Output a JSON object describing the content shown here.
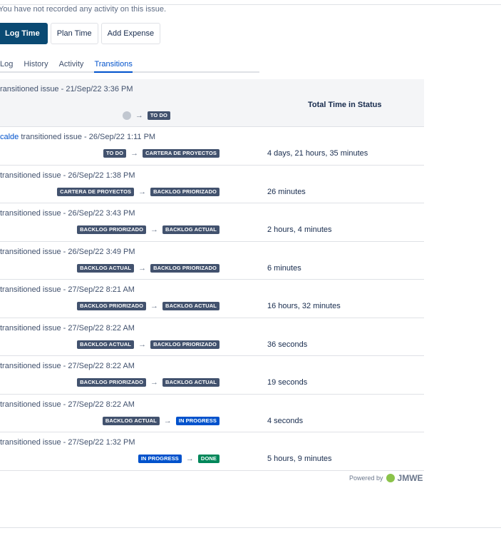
{
  "status_message": "You have not recorded any activity on this issue.",
  "buttons": {
    "log_time": "Log Time",
    "plan_time": "Plan Time",
    "add_expense": "Add Expense"
  },
  "tabs": [
    {
      "label": "Log",
      "active": false
    },
    {
      "label": "History",
      "active": false
    },
    {
      "label": "Activity",
      "active": false
    },
    {
      "label": "Transitions",
      "active": true
    }
  ],
  "table": {
    "header": {
      "who": "ransitioned issue - 21/Sep/22 3:36 PM",
      "to": "TO DO",
      "total_time_label": "Total Time in Status"
    },
    "rows": [
      {
        "user": "calde",
        "who": " transitioned issue - 26/Sep/22 1:11 PM",
        "from": "TO DO",
        "from_color": "grey",
        "to": "CARTERA DE PROYECTOS",
        "to_color": "grey",
        "duration": "4 days, 21 hours, 35 minutes"
      },
      {
        "user": "",
        "who": " transitioned issue - 26/Sep/22 1:38 PM",
        "from": "CARTERA DE PROYECTOS",
        "from_color": "grey",
        "to": "BACKLOG PRIORIZADO",
        "to_color": "grey",
        "duration": "26 minutes"
      },
      {
        "user": "",
        "who": " transitioned issue - 26/Sep/22 3:43 PM",
        "from": "BACKLOG PRIORIZADO",
        "from_color": "grey",
        "to": "BACKLOG ACTUAL",
        "to_color": "grey",
        "duration": "2 hours, 4 minutes"
      },
      {
        "user": "",
        "who": " transitioned issue - 26/Sep/22 3:49 PM",
        "from": "BACKLOG ACTUAL",
        "from_color": "grey",
        "to": "BACKLOG PRIORIZADO",
        "to_color": "grey",
        "duration": "6 minutes"
      },
      {
        "user": "",
        "who": " transitioned issue - 27/Sep/22 8:21 AM",
        "from": "BACKLOG PRIORIZADO",
        "from_color": "grey",
        "to": "BACKLOG ACTUAL",
        "to_color": "grey",
        "duration": "16 hours, 32 minutes"
      },
      {
        "user": "",
        "who": " transitioned issue - 27/Sep/22 8:22 AM",
        "from": "BACKLOG ACTUAL",
        "from_color": "grey",
        "to": "BACKLOG PRIORIZADO",
        "to_color": "grey",
        "duration": "36 seconds"
      },
      {
        "user": "",
        "who": " transitioned issue - 27/Sep/22 8:22 AM",
        "from": "BACKLOG PRIORIZADO",
        "from_color": "grey",
        "to": "BACKLOG ACTUAL",
        "to_color": "grey",
        "duration": "19 seconds"
      },
      {
        "user": "",
        "who": " transitioned issue - 27/Sep/22 8:22 AM",
        "from": "BACKLOG ACTUAL",
        "from_color": "grey",
        "to": "IN PROGRESS",
        "to_color": "blue",
        "duration": "4 seconds"
      },
      {
        "user": "",
        "who": " transitioned issue - 27/Sep/22 1:32 PM",
        "from": "IN PROGRESS",
        "from_color": "blue",
        "to": "DONE",
        "to_color": "green",
        "duration": "5 hours, 9 minutes"
      }
    ]
  },
  "footer": {
    "powered_by": "Powered by",
    "brand": "JMWE"
  }
}
